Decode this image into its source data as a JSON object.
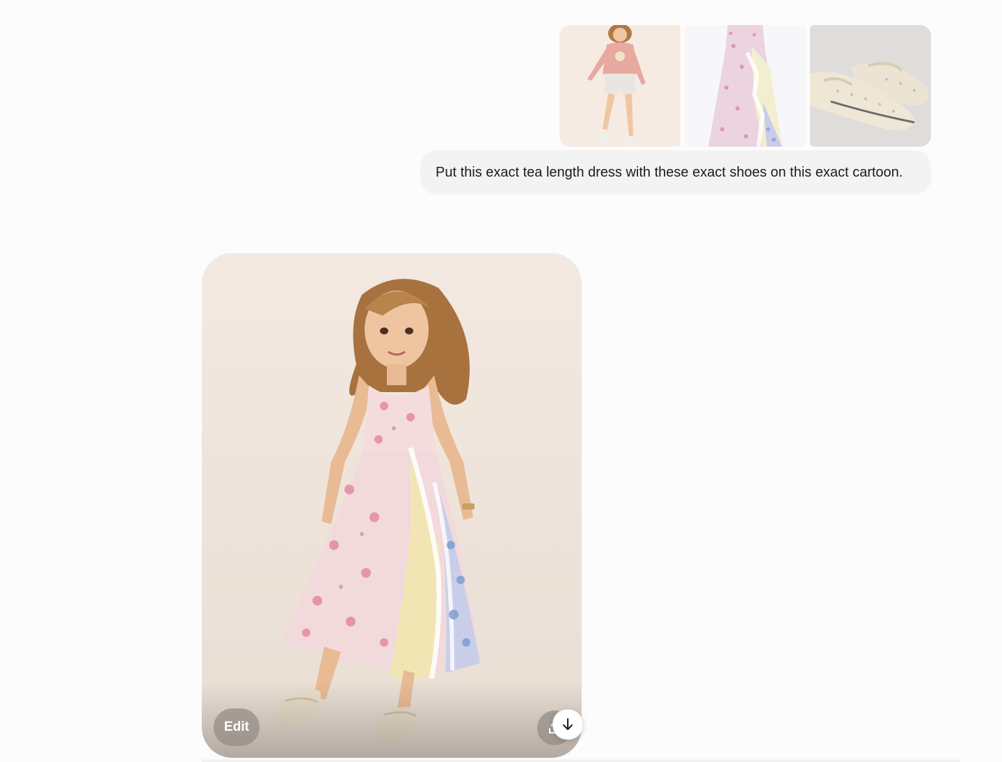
{
  "user_message": {
    "attachments": [
      {
        "icon": "cartoon-girl-image"
      },
      {
        "icon": "floral-dress-image"
      },
      {
        "icon": "beaded-shoes-image"
      }
    ],
    "text": "Put this exact tea length dress with these exact shoes on this exact cartoon."
  },
  "generated_image": {
    "icon": "generated-outfit-image",
    "edit_label": "Edit",
    "share_icon": "share-icon"
  },
  "scroll_button": {
    "icon": "arrow-down-icon"
  },
  "colors": {
    "page_bg": "#fcfcfc",
    "bubble_bg": "#f3f3f3",
    "text": "#1b1b1b",
    "image_bg": "#f3e9e0"
  }
}
